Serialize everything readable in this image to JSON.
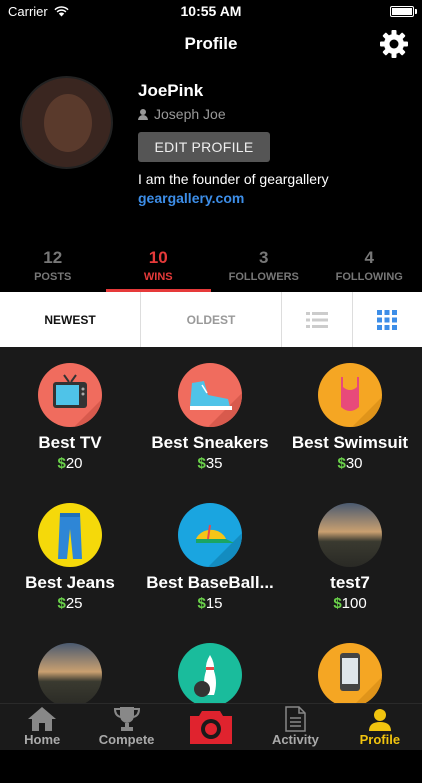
{
  "status_bar": {
    "carrier": "Carrier",
    "time": "10:55 AM"
  },
  "nav": {
    "title": "Profile",
    "settings_icon": "gear-icon"
  },
  "profile": {
    "username": "JoePink",
    "real_name": "Joseph Joe",
    "edit_label": "EDIT PROFILE",
    "bio": "I am the founder of geargallery",
    "link": "geargallery.com"
  },
  "stats": [
    {
      "num": "12",
      "label": "POSTS"
    },
    {
      "num": "10",
      "label": "WINS"
    },
    {
      "num": "3",
      "label": "FOLLOWERS"
    },
    {
      "num": "4",
      "label": "FOLLOWING"
    }
  ],
  "sort": {
    "newest": "NEWEST",
    "oldest": "OLDEST",
    "active_color": "#3d8ee8"
  },
  "items": [
    {
      "name": "Best TV",
      "currency": "$",
      "price": "20",
      "icon": "tv-icon",
      "color": "#f06c5e"
    },
    {
      "name": "Best Sneakers",
      "currency": "$",
      "price": "35",
      "icon": "sneaker-icon",
      "color": "#f06c5e"
    },
    {
      "name": "Best Swimsuit",
      "currency": "$",
      "price": "30",
      "icon": "swimsuit-icon",
      "color": "#f5a623"
    },
    {
      "name": "Best Jeans",
      "currency": "$",
      "price": "25",
      "icon": "jeans-icon",
      "color": "#f5d90a"
    },
    {
      "name": "Best BaseBall...",
      "currency": "$",
      "price": "15",
      "icon": "baseball-cap-icon",
      "color": "#1aa5e0"
    },
    {
      "name": "test7",
      "currency": "$",
      "price": "100",
      "icon": "landscape-photo",
      "color": "#3b3b3b"
    },
    {
      "name": "",
      "currency": "",
      "price": "",
      "icon": "landscape-photo",
      "color": "#3b3b3b"
    },
    {
      "name": "",
      "currency": "",
      "price": "",
      "icon": "bowling-icon",
      "color": "#1abc9c"
    },
    {
      "name": "",
      "currency": "",
      "price": "",
      "icon": "phone-icon",
      "color": "#f5a623"
    }
  ],
  "tabs": [
    {
      "label": "Home",
      "icon": "home-icon"
    },
    {
      "label": "Compete",
      "icon": "trophy-icon"
    },
    {
      "label": "",
      "icon": "camera-icon"
    },
    {
      "label": "Activity",
      "icon": "document-icon"
    },
    {
      "label": "Profile",
      "icon": "person-icon"
    }
  ],
  "colors": {
    "accent_red": "#e63a3a",
    "accent_yellow": "#f1c40f",
    "link_blue": "#3d8ee8",
    "price_green": "#6ad14a"
  }
}
